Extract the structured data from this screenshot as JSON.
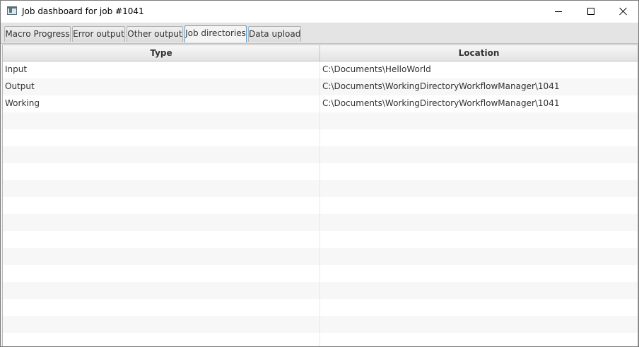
{
  "window": {
    "title": "Job dashboard for job #1041",
    "icon": "app-window-icon",
    "controls": [
      "minimize-icon",
      "maximize-icon",
      "close-icon"
    ]
  },
  "tabs": [
    {
      "label": "Macro Progress",
      "selected": false
    },
    {
      "label": "Error output",
      "selected": false
    },
    {
      "label": "Other output",
      "selected": false
    },
    {
      "label": "Job directories",
      "selected": true
    },
    {
      "label": "Data upload",
      "selected": false
    }
  ],
  "table": {
    "columns": [
      "Type",
      "Location"
    ],
    "rows": [
      {
        "type": "Input",
        "location": "C:\\Documents\\HelloWorld"
      },
      {
        "type": "Output",
        "location": "C:\\Documents\\WorkingDirectoryWorkflowManager\\1041"
      },
      {
        "type": "Working",
        "location": "C:\\Documents\\WorkingDirectoryWorkflowManager\\1041"
      }
    ]
  },
  "colors": {
    "selected_tab_border": "#5aa0d6",
    "row_alt": "#f7f7f7"
  }
}
